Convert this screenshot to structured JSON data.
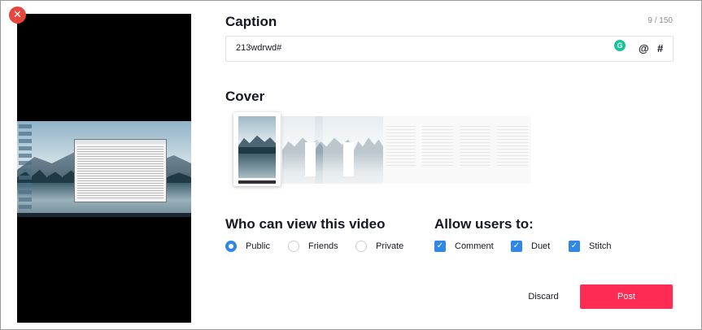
{
  "caption": {
    "label": "Caption",
    "count": "9 / 150",
    "value": "213wdrwd#",
    "mention_symbol": "@",
    "hashtag_symbol": "#",
    "grammarly_letter": "G"
  },
  "cover": {
    "label": "Cover"
  },
  "privacy": {
    "label": "Who can view this video",
    "options": [
      "Public",
      "Friends",
      "Private"
    ],
    "selected": "Public"
  },
  "allow": {
    "label": "Allow users to:",
    "options": [
      {
        "label": "Comment",
        "checked": true
      },
      {
        "label": "Duet",
        "checked": true
      },
      {
        "label": "Stitch",
        "checked": true
      }
    ]
  },
  "actions": {
    "discard": "Discard",
    "post": "Post"
  },
  "icons": {
    "close": "close-icon",
    "grammarly": "grammarly-icon",
    "check": "checkmark-icon"
  },
  "colors": {
    "accent": "#fe2c55",
    "selection": "#3087e5",
    "close": "#e8453c",
    "grammarly": "#15c39a"
  }
}
